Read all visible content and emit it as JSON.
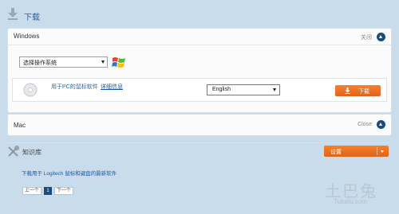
{
  "header": {
    "title": "下载",
    "icon": "download-icon"
  },
  "windows_panel": {
    "title": "Windows",
    "toggle_label": "关闭",
    "os_select": {
      "value": "选择操作系统"
    },
    "software": {
      "label": "用于PC的鼠标软件",
      "details_link": "详细信息",
      "language_select": {
        "value": "English"
      },
      "download_button": "下载"
    }
  },
  "mac_panel": {
    "title": "Mac",
    "toggle_label": "Close"
  },
  "knowledge_base": {
    "title": "知识库",
    "settings_button": "设置",
    "link_text": "下载用于 Logitech 鼠标和键盘的最新软件",
    "pager": {
      "prev": "上一个",
      "current": "1",
      "next": "下一个"
    }
  },
  "watermark": {
    "big": "土巴兔",
    "small": "Tubatu.com"
  },
  "colors": {
    "background": "#c9dcec",
    "accent_orange": "#e8691f",
    "nav_blue": "#1d4c7c",
    "link_blue": "#1d58a6"
  }
}
